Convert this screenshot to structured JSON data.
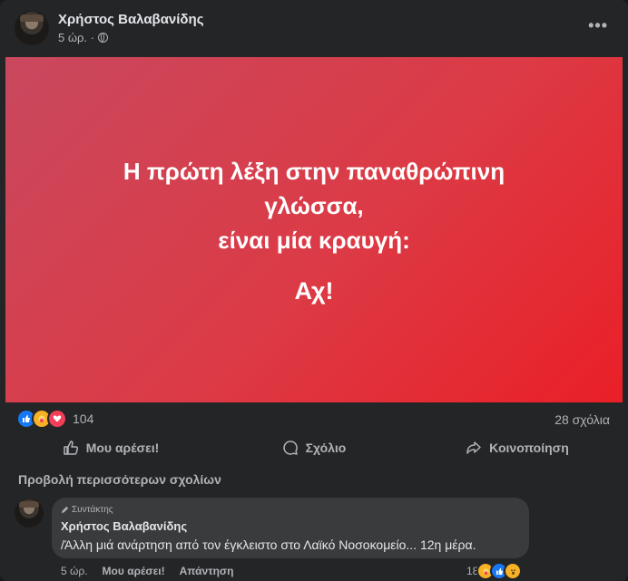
{
  "post": {
    "author": "Χρήστος Βαλαβανίδης",
    "time": "5 ώρ. ·",
    "more_label": "•••",
    "banner": {
      "line1": "Η πρώτη λέξη στην παναθρώπινη γλώσσα,",
      "line2": "είναι μία κραυγή:",
      "line3": "Αχ!",
      "gradient": [
        "#c9485e",
        "#ea1f27"
      ]
    },
    "reactions": {
      "count": "104",
      "types": [
        "like-icon",
        "care-icon",
        "love-icon"
      ]
    },
    "comments_count": "28 σχόλια",
    "actions": {
      "like": "Μου αρέσει!",
      "comment": "Σχόλιο",
      "share": "Κοινοποίηση"
    }
  },
  "comments_section": {
    "more_comments": "Προβολή περισσότερων σχολίων",
    "comment": {
      "badge": "Συντάκτης",
      "author": "Χρήστος Βαλαβανίδης",
      "text": "/Άλλη μιά ανάρτηση από τον έγκλειστο στο Λαϊκό Νοσοκομείο... 12η μέρα.",
      "time": "5 ώρ.",
      "like": "Μου αρέσει!",
      "reply": "Απάντηση",
      "reaction_count": "18"
    }
  },
  "colors": {
    "card_bg": "#242526",
    "page_bg": "#18191a",
    "bubble_bg": "#3a3b3c",
    "text_primary": "#e4e6eb",
    "text_secondary": "#b0b3b8"
  }
}
